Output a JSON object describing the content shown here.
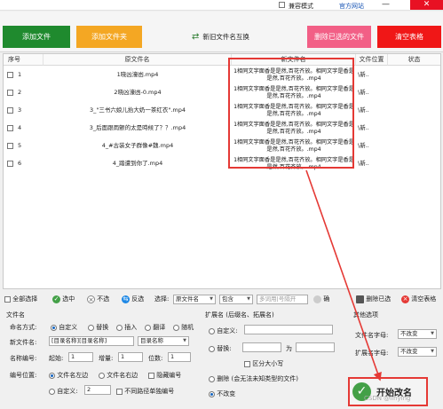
{
  "titlebar": {
    "compat_label": "兼容模式",
    "site_label": "官方网站"
  },
  "toolbar": {
    "add_file": "添加文件",
    "add_folder": "添加文件夹",
    "swap_names": "新旧文件名互换",
    "delete_selected": "删除已选的文件",
    "clear_table": "清空表格",
    "colors": {
      "add_file": "#1f8a2e",
      "add_folder": "#f4a723",
      "delete_selected": "#f25f86",
      "clear_table": "#f01717"
    }
  },
  "table": {
    "headers": {
      "seq": "序号",
      "orig": "原文件名",
      "new": "新文件名",
      "location": "文件位置",
      "status": "状态"
    },
    "rows": [
      {
        "seq": "1",
        "orig": "1晓凶濠凼.mp4",
        "new": "1相同文字面香是是然,百花齐放。相同文字是香是是然,百花齐放。.mp4",
        "loc": "\\新.."
      },
      {
        "seq": "2",
        "orig": "2晓凶濠凼-0.mp4",
        "new": "1相同文字面香是是然,百花齐放。相同文字是香是是然,百花齐放。.mp4",
        "loc": "\\新.."
      },
      {
        "seq": "3",
        "orig": "3_\"三书六娘儿抬大奶一茶红衣\".mp4",
        "new": "1相同文字面香是是然,百花齐放。相同文字是香是是然,百花齐放。.mp4",
        "loc": "\\新.."
      },
      {
        "seq": "4",
        "orig": "3_后面跟雨颤的太是時候了？？.mp4",
        "new": "1相同文字面香是是然,百花齐放。相同文字是香是是然,百花齐放。.mp4",
        "loc": "\\新.."
      },
      {
        "seq": "5",
        "orig": "4_#古装女子群像#魏.mp4",
        "new": "1相同文字面香是是然,百花齐放。相同文字是香是是然,百花齐放。.mp4",
        "loc": "\\新.."
      },
      {
        "seq": "6",
        "orig": "4_踏遭到你了.mp4",
        "new": "1相同文字面香是是然,百花齐放。相同文字是香是是然,百花齐放。.mp4",
        "loc": "\\新.."
      }
    ]
  },
  "actionbar": {
    "select_all": "全部选择",
    "select": "选中",
    "unselect": "不选",
    "invert": "反选",
    "choose_label": "选择:",
    "choose_field": "原文件名",
    "contains": "包含",
    "keywords_placeholder": "多词用|号隔开",
    "confirm": "确",
    "delete_selected": "删除已选",
    "clear_table": "清空表格"
  },
  "filename_panel": {
    "title": "文件名",
    "naming_mode": "命名方式:",
    "modes": [
      "自定义",
      "替换",
      "插入",
      "翻译",
      "随机"
    ],
    "new_filename_label": "新文件名:",
    "new_filename_value": "[目录名称][目录名称]",
    "dir_name_select": "目录名称",
    "seq_label": "名称编号:",
    "start_label": "起始:",
    "start_value": "1",
    "increment_label": "增量:",
    "increment_value": "1",
    "digits_label": "位数:",
    "digits_value": "1",
    "position_label": "编号位置:",
    "positions": [
      "文件名左边",
      "文件名右边",
      "隐藏编号"
    ],
    "custom_label": "自定义:",
    "custom_value": "2",
    "diff_path_label": "不同路径单独编号"
  },
  "extension_panel": {
    "title": "扩展名 (后缀名、拓展名)",
    "custom": "自定义:",
    "replace": "替换:",
    "as_label": "为",
    "case_sensitive": "区分大小写",
    "delete_label": "删除 (会无法未知类型的文件)",
    "no_change": "不改变"
  },
  "other_panel": {
    "title": "其他选项",
    "filename_case_label": "文件名字母:",
    "filename_case_value": "不改变",
    "ext_case_label": "扩展名字母:",
    "ext_case_value": "不改变"
  },
  "start_button": {
    "label": "开始改名",
    "watermark": "CSDN @linying"
  }
}
